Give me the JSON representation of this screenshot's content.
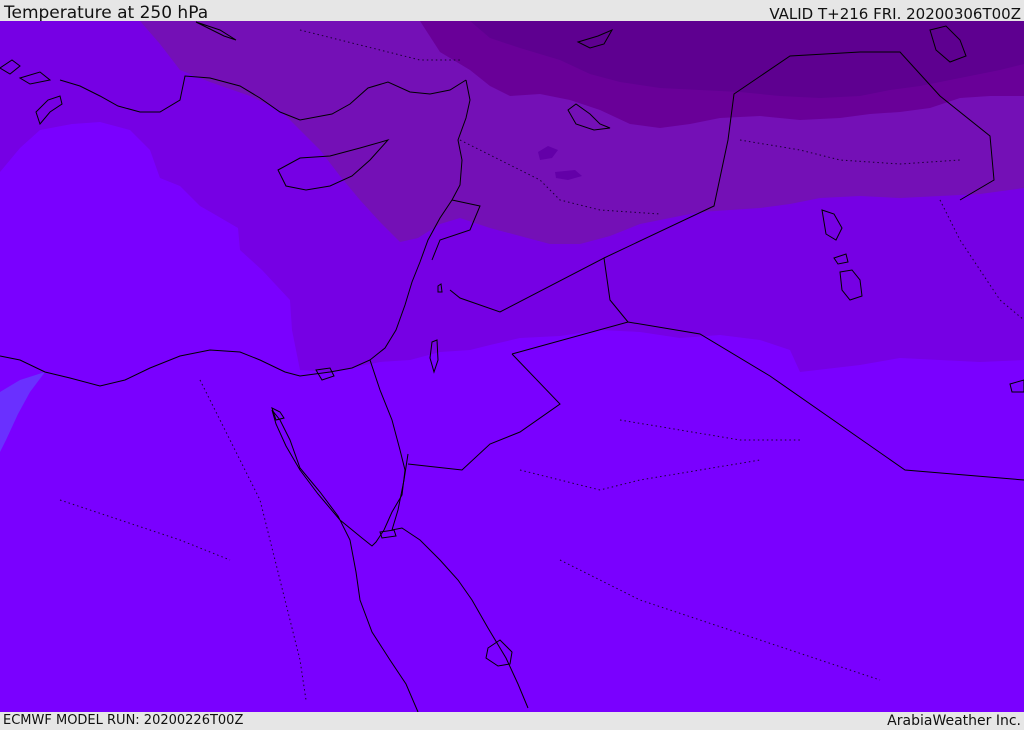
{
  "header": {
    "title": "Temperature at 250 hPa",
    "valid": "VALID T+216 FRI. 20200306T00Z"
  },
  "footer": {
    "model_run": "ECMWF MODEL RUN: 20200226T00Z",
    "brand": "ArabiaWeather Inc."
  },
  "map": {
    "region": "Eastern Mediterranean, Egypt, Levant, Arabian Peninsula",
    "colors": {
      "base": "#7a00ff",
      "zone_light": "#7600e4",
      "zone_mid": "#7410b6",
      "zone_dark": "#690098",
      "zone_darker": "#5e0090",
      "cold_patch": "#6300a8",
      "warm_patch": "#6a30ff",
      "borders": "#000000"
    }
  }
}
